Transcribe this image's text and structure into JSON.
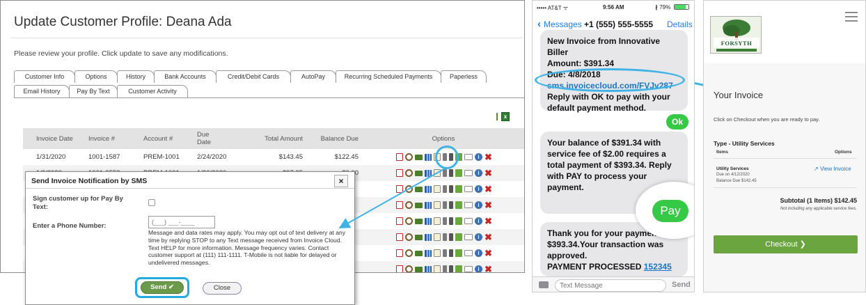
{
  "profile": {
    "title": "Update Customer Profile: Deana Ada",
    "intro": "Please review your profile. Click update to save any modifications.",
    "tabs_row1": [
      "Customer Info",
      "Options",
      "History",
      "Bank Accounts",
      "Credit/Debit Cards",
      "AutoPay",
      "Recurring Scheduled Payments",
      "Paperless"
    ],
    "tabs_row2": [
      "Email History",
      "Pay By Text",
      "Customer Activity"
    ],
    "active_tab": "History",
    "table": {
      "headers": {
        "date": "Invoice Date",
        "invoice": "Invoice #",
        "account": "Account #",
        "due": "Due Date",
        "total": "Total Amount",
        "balance": "Balance Due",
        "options": "Options"
      },
      "rows": [
        {
          "date": "1/31/2020",
          "invoice": "1001-1587",
          "account": "PREM-1001",
          "due": "2/24/2020",
          "total": "$143.45",
          "balance": "$122.45"
        },
        {
          "date": "1/2/2020",
          "invoice": "1001-2558",
          "account": "PREM-1001",
          "due": "1/26/2020",
          "total": "$97.85",
          "balance": "$0.00"
        }
      ]
    }
  },
  "dialog": {
    "title": "Send Invoice Notification by SMS",
    "close_glyph": "×",
    "signup_label": "Sign customer up for Pay By Text:",
    "phone_label": "Enter a Phone Number:",
    "phone_placeholder": "(___) ___-____",
    "notice": "Message and data rates may apply. You may opt out of text delivery at any time by replying STOP to any Text message received from Invoice Cloud. Text HELP for more information. Message frequency varies. Contact customer support at (111) 111-1111. T-Mobile is not liable for delayed or undelivered messages.",
    "send_label": "Send ✔",
    "close_label": "Close"
  },
  "phone": {
    "status": {
      "carrier": "••••• AT&T ᯤ",
      "time": "9:56 AM",
      "battery": "∦ 79%",
      "battery_level": 0.79
    },
    "nav": {
      "back_label": "Messages",
      "contact": "+1 (555) 555-5555",
      "details_label": "Details"
    },
    "messages": {
      "m1_line1": "New Invoice from Innovative Biller",
      "m1_line2": "Amount: $391.34",
      "m1_line3": "Due: 4/8/2018",
      "m1_link": "sms.invoicecloud.com/FVJv287",
      "m1_line4": "Reply with OK to pay with your default payment method.",
      "ok_reply": "Ok",
      "m2": "Your balance of $391.34 with service fee of $2.00 requires a total payment of $393.34. Reply with PAY to process your payment.",
      "pay_reply": "Pay",
      "m3_text": "Thank you for your payment of $393.34.Your transaction was approved.",
      "m3_processed": "PAYMENT PROCESSED",
      "m3_code": "152345"
    },
    "compose": {
      "placeholder": "Text Message",
      "send_label": "Send"
    }
  },
  "portal": {
    "logo_text": "FORSYTH",
    "heading": "Your Invoice",
    "instruction": "Click on Checkout when you are ready to pay.",
    "type_label": "Type - Utility Services",
    "col_items": "Items",
    "col_options": "Options",
    "item": {
      "name": "Utility Services",
      "due": "Due on 4/12/2020",
      "balance": "Balance Due $142.45"
    },
    "view_invoice_label": "View Invoice",
    "subtotal": "Subtotal (1 Items)   $142.45",
    "subtotal_note": "Not including any applicable service fees.",
    "checkout_label": "Checkout  ❯"
  },
  "colors": {
    "highlight": "#3fb3e6",
    "sms_green": "#36c945",
    "checkout_green": "#6aa540",
    "ios_blue": "#1a7ef0"
  }
}
